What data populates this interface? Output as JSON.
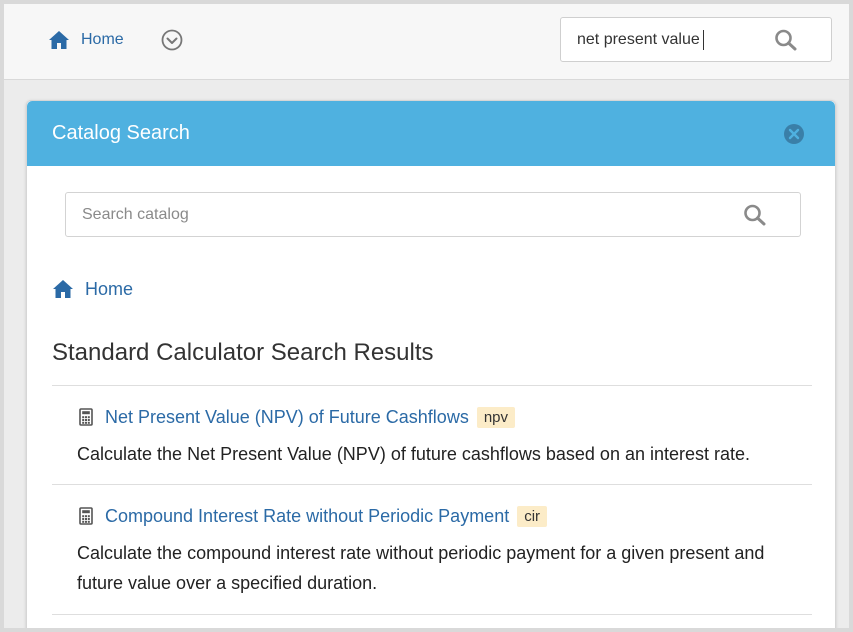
{
  "topbar": {
    "home_label": "Home",
    "search_value": "net present value"
  },
  "panel": {
    "title": "Catalog Search",
    "search_placeholder": "Search catalog",
    "breadcrumb_label": "Home",
    "results_title": "Standard Calculator Search Results",
    "results": [
      {
        "title": "Net Present Value (NPV) of Future Cashflows",
        "tag": "npv",
        "description": "Calculate the Net Present Value (NPV) of future cashflows based on an interest rate."
      },
      {
        "title": "Compound Interest Rate without Periodic Payment",
        "tag": "cir",
        "description": "Calculate the compound interest rate without periodic payment for a given present and future value over a specified duration."
      }
    ]
  },
  "colors": {
    "header_blue": "#4fb1e0",
    "link_blue": "#2b6aa6",
    "tag_bg": "#fcecc8"
  },
  "icons": [
    "home-icon",
    "chevron-down-circle-icon",
    "search-icon",
    "close-circle-icon",
    "calculator-icon"
  ]
}
